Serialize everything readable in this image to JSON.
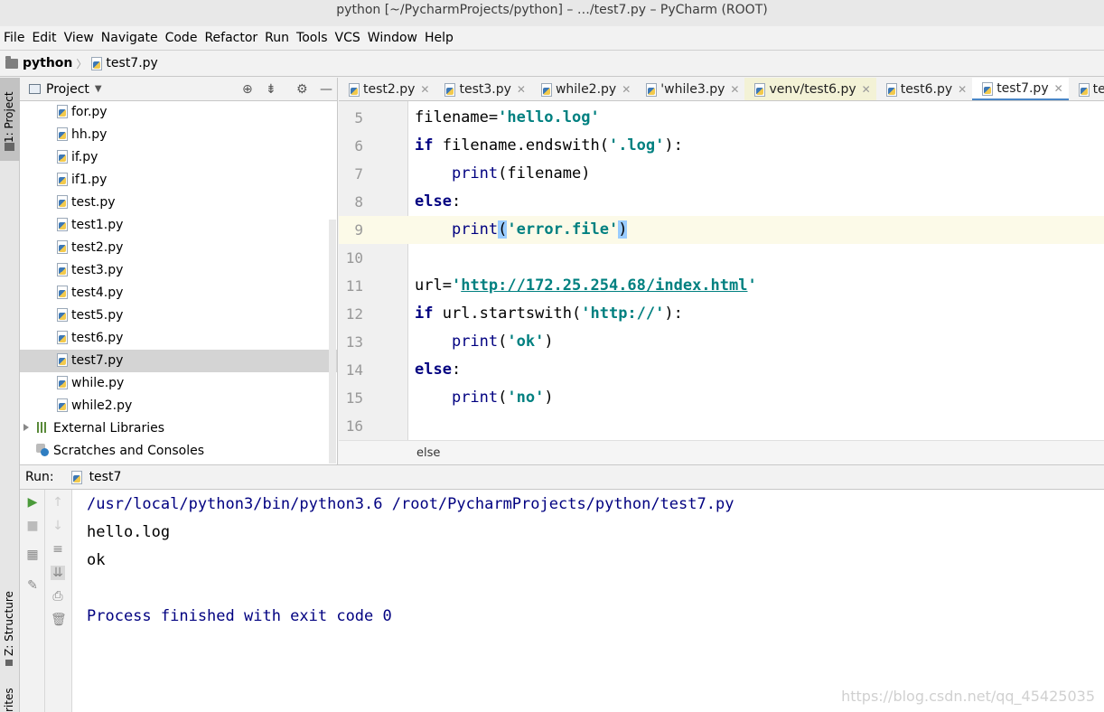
{
  "window": {
    "title": "python [~/PycharmProjects/python] – …/test7.py – PyCharm (ROOT)"
  },
  "menu": [
    "File",
    "Edit",
    "View",
    "Navigate",
    "Code",
    "Refactor",
    "Run",
    "Tools",
    "VCS",
    "Window",
    "Help"
  ],
  "breadcrumb": {
    "project": "python",
    "file": "test7.py"
  },
  "left_strip": {
    "project_label": "1: Project",
    "structure_label": "Z: Structure",
    "favorites_label": "rites"
  },
  "project_panel": {
    "title": "Project",
    "files": [
      "for.py",
      "hh.py",
      "if.py",
      "if1.py",
      "test.py",
      "test1.py",
      "test2.py",
      "test3.py",
      "test4.py",
      "test5.py",
      "test6.py",
      "test7.py",
      "while.py",
      "while2.py"
    ],
    "selected": "test7.py",
    "external_libraries": "External Libraries",
    "scratches": "Scratches and Consoles"
  },
  "tabs": [
    "test2.py",
    "test3.py",
    "while2.py",
    "'while3.py",
    "venv/test6.py",
    "test6.py",
    "test7.py",
    "te"
  ],
  "active_tab": "test7.py",
  "editor": {
    "line_numbers": [
      "5",
      "6",
      "7",
      "8",
      "9",
      "10",
      "11",
      "12",
      "13",
      "14",
      "15",
      "16"
    ],
    "current_line": "9",
    "breadcrumb": "else"
  },
  "run": {
    "label": "Run:",
    "config": "test7",
    "output": [
      "/usr/local/python3/bin/python3.6 /root/PycharmProjects/python/test7.py",
      "hello.log",
      "ok",
      "",
      "Process finished with exit code 0"
    ]
  },
  "watermark": "https://blog.csdn.net/qq_45425035",
  "colors": {
    "keyword": "#000080",
    "string": "#008080",
    "console_path": "#000080",
    "active_tab_underline": "#4a86c7"
  }
}
